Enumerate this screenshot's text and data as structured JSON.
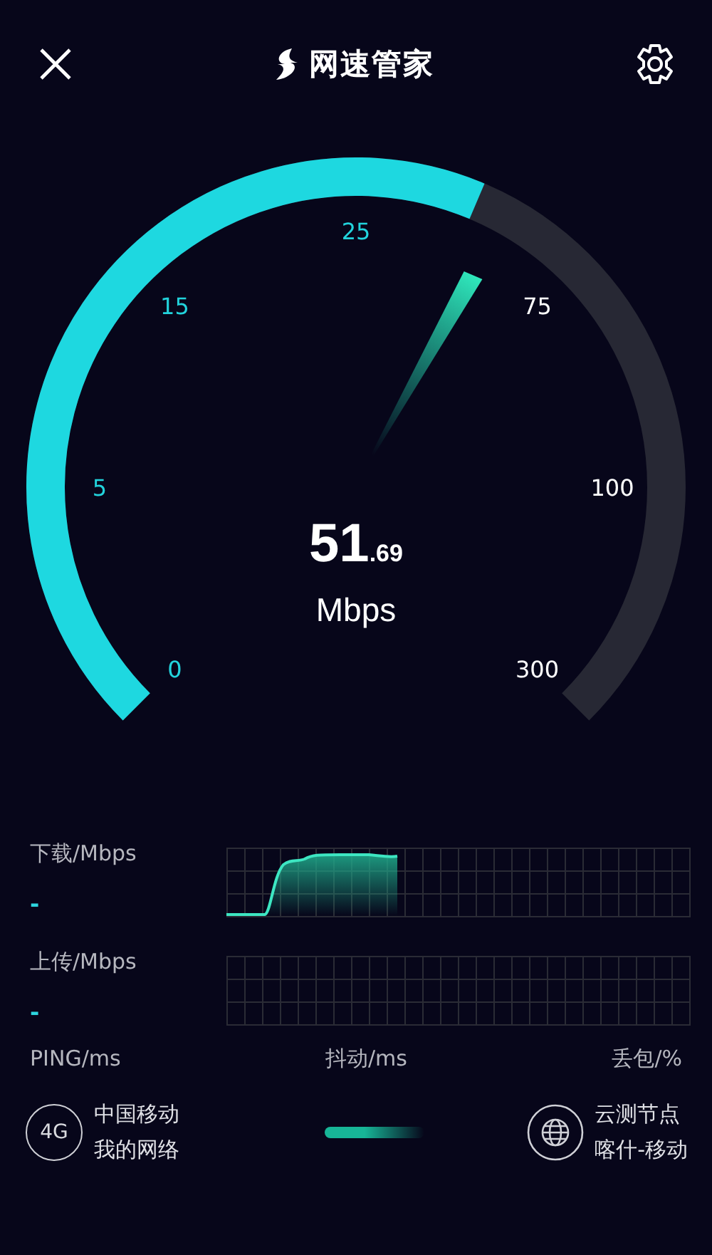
{
  "header": {
    "title": "网速管家"
  },
  "gauge": {
    "ticks": [
      "0",
      "5",
      "15",
      "25",
      "75",
      "100",
      "300"
    ],
    "value": "51$_{.69}$",
    "unit": "Mbps"
  },
  "metrics": [
    {
      "label": "下载/Mbps",
      "value": "-",
      "kind": "active"
    },
    {
      "label": "上传/Mbps",
      "value": "-",
      "kind": "idle"
    }
  ],
  "stats": [
    "PING/ms",
    "抖动/ms",
    "丢包/%"
  ],
  "network": {
    "badge": "4G",
    "carrier": "中国移动",
    "label": "我的网络"
  },
  "node": {
    "title": "云测节点",
    "location": "喀什-移动"
  }
}
